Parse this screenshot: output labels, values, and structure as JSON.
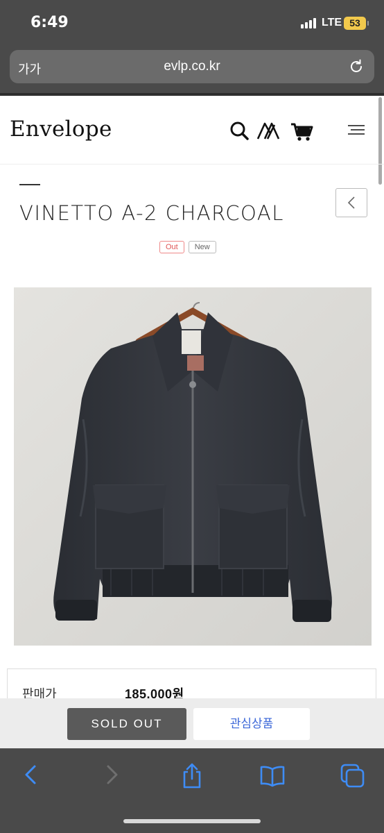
{
  "status_bar": {
    "time": "6:49",
    "network": "LTE",
    "battery": "53"
  },
  "url_bar": {
    "text_size_label": "가가",
    "url": "evlp.co.kr"
  },
  "site": {
    "logo": "Envelope"
  },
  "product": {
    "title": "VINETTO A-2 CHARCOAL",
    "badges": {
      "out": "Out",
      "new": "New"
    },
    "price_label": "판매가",
    "price": "185,000원"
  },
  "actions": {
    "sold_out": "SOLD OUT",
    "wishlist": "관심상품"
  },
  "colors": {
    "accent_blue": "#3a66d8",
    "sold_out_bg": "#5a5a5a",
    "badge_red": "#e05555",
    "battery": "#f2c94c"
  },
  "icons": [
    "search-icon",
    "brand-mark-icon",
    "cart-icon",
    "menu-icon",
    "back-arrow-icon",
    "reload-icon",
    "share-icon",
    "bookmarks-icon",
    "tabs-icon"
  ]
}
